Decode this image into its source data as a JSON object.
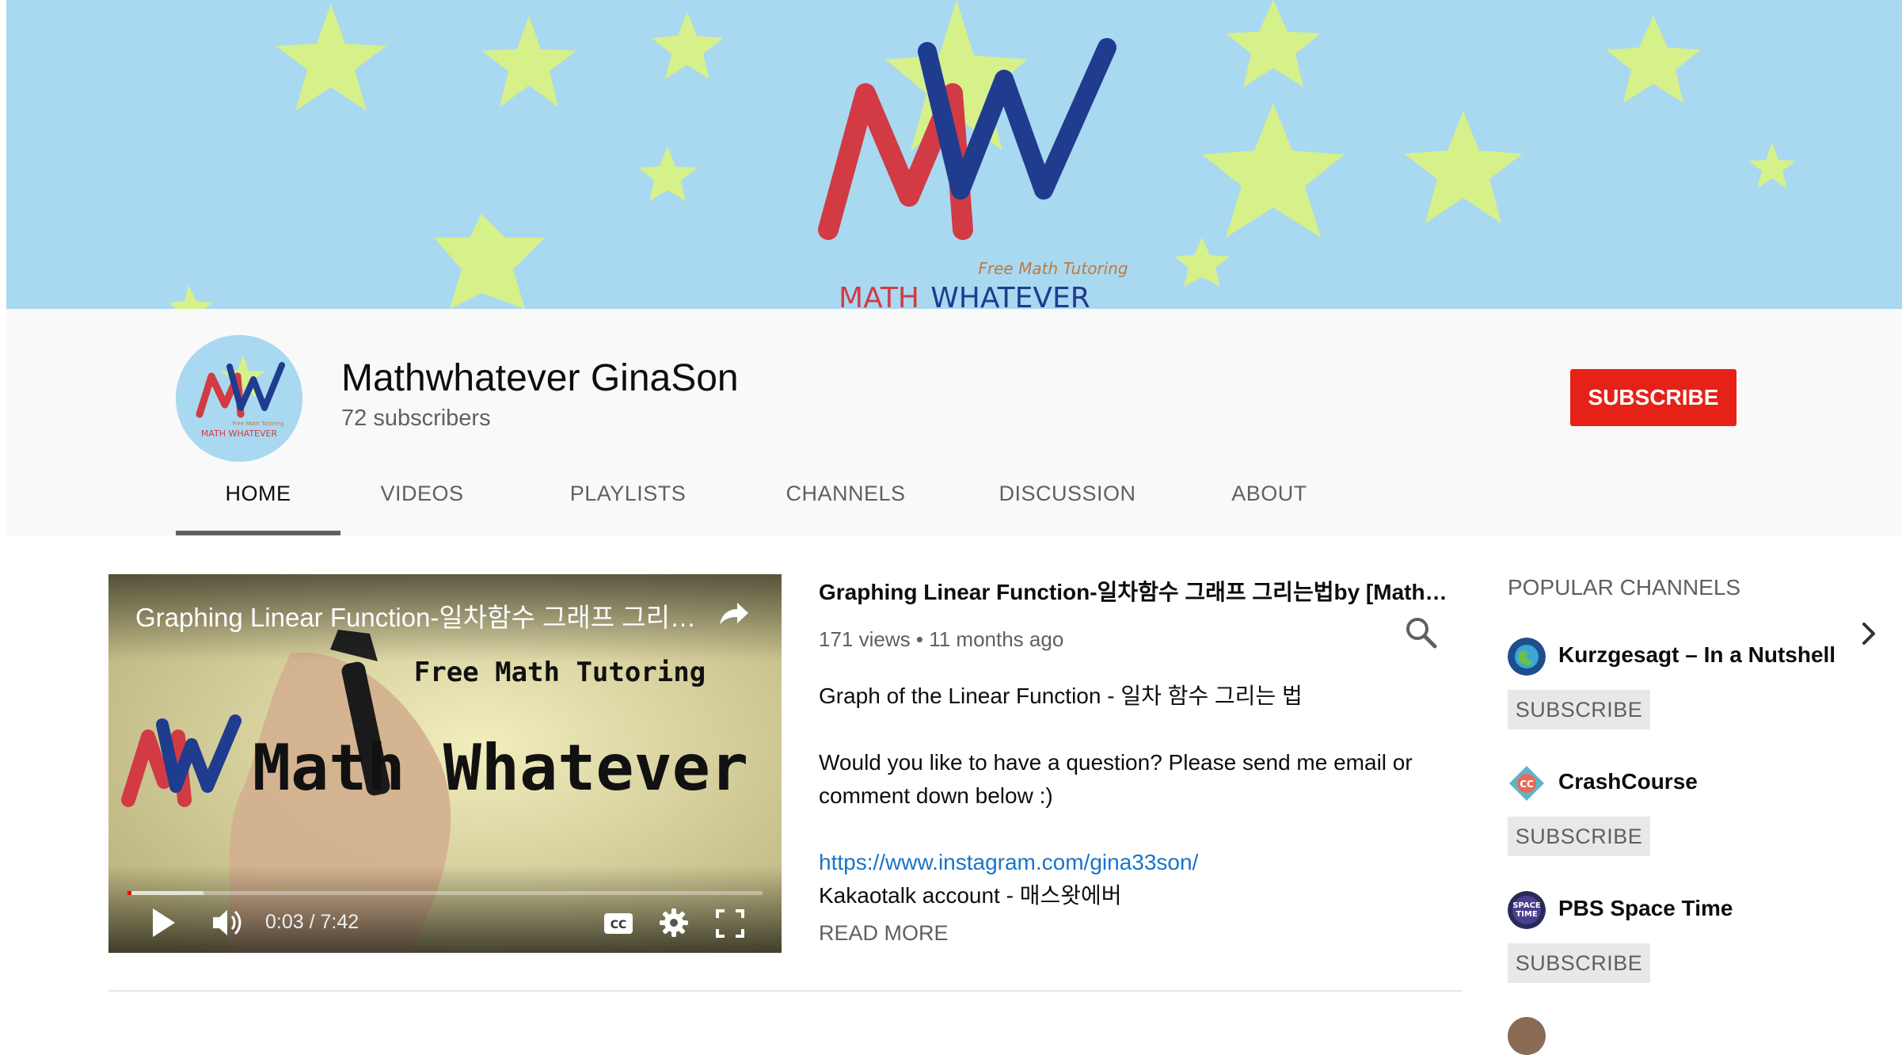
{
  "banner": {
    "logo_letters": "MW",
    "tagline": "Free Math Tutoring",
    "brand_first": "MATH",
    "brand_second": "WHATEVER",
    "colors": {
      "sky": "#a9d8f1",
      "star": "#d6f08a",
      "red": "#d23b44",
      "blue": "#1f3c8f"
    }
  },
  "channel": {
    "name": "Mathwhatever GinaSon",
    "subscribers": "72 subscribers",
    "subscribe_label": "SUBSCRIBE",
    "avatar_tagline": "Free Math Tutoring",
    "avatar_brand": "MATH WHATEVER"
  },
  "tabs": [
    {
      "label": "HOME",
      "active": true
    },
    {
      "label": "VIDEOS"
    },
    {
      "label": "PLAYLISTS"
    },
    {
      "label": "CHANNELS"
    },
    {
      "label": "DISCUSSION"
    },
    {
      "label": "ABOUT"
    }
  ],
  "tab_icons": {
    "search": "search-icon",
    "next": "chevron-right-icon"
  },
  "featured_video": {
    "overlay_title": "Graphing Linear Function-일차함수 그래프 그리는법by [Mathwhatever]",
    "thumbnail_tagline": "Free Math Tutoring",
    "thumbnail_brand": "Math Whatever",
    "time_current": "0:03",
    "time_total": "7:42",
    "time_display": "0:03 / 7:42",
    "progress_played_fraction": 0.0065,
    "progress_loaded_fraction": 0.12,
    "controls": [
      "play-icon",
      "volume-icon",
      "closed-captions-icon",
      "settings-gear-icon",
      "fullscreen-icon",
      "share-icon"
    ]
  },
  "video_info": {
    "title": "Graphing Linear Function-일차함수 그래프 그리는법by [Mathwhatever]",
    "views": "171 views",
    "separator": "•",
    "age": "11 months ago",
    "desc_line1": "Graph of the Linear Function - 일차 함수 그리는 법",
    "desc_line2": "Would you like to have a question? Please send me email or comment down below :)",
    "link": "https://www.instagram.com/gina33son/",
    "desc_line3": "Kakaotalk account - 매스왓에버",
    "read_more": "READ MORE"
  },
  "popular_channels": {
    "heading": "POPULAR CHANNELS",
    "subscribe_label": "SUBSCRIBE",
    "items": [
      {
        "name": "Kurzgesagt – In a Nutshell",
        "icon": "kurzgesagt-globe-icon",
        "icon_color": "#1f4e8c"
      },
      {
        "name": "CrashCourse",
        "icon": "crashcourse-logo-icon",
        "icon_color": "#e86a5a"
      },
      {
        "name": "PBS Space Time",
        "icon": "pbs-space-time-icon",
        "icon_color": "#2a2a5a"
      }
    ]
  }
}
